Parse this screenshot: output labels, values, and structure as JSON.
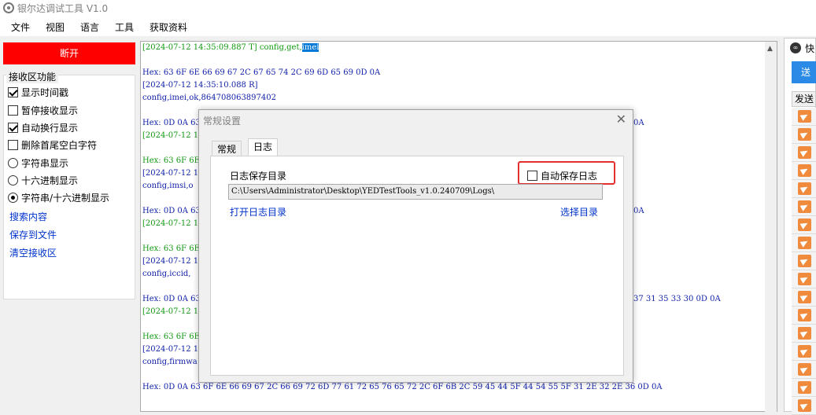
{
  "window": {
    "title": "银尔达调试工具 V1.0"
  },
  "menu": [
    "文件",
    "视图",
    "语言",
    "工具",
    "获取资料"
  ],
  "left": {
    "disconnect_label": "断开",
    "group_title": "接收区功能",
    "options": [
      {
        "label": "显示时间戳",
        "type": "checkbox",
        "checked": true
      },
      {
        "label": "暂停接收显示",
        "type": "checkbox",
        "checked": false
      },
      {
        "label": "自动换行显示",
        "type": "checkbox",
        "checked": true
      },
      {
        "label": "删除首尾空白字符",
        "type": "checkbox",
        "checked": false
      },
      {
        "label": "字符串显示",
        "type": "radio",
        "checked": false
      },
      {
        "label": "十六进制显示",
        "type": "radio",
        "checked": false
      },
      {
        "label": "字符串/十六进制显示",
        "type": "radio",
        "checked": true
      }
    ],
    "links": [
      "搜索内容",
      "保存到文件",
      "清空接收区"
    ]
  },
  "log": {
    "lines": [
      {
        "color": "green",
        "text": "[2024-07-12 14:35:09.887 T] config,get,",
        "sel": "imei"
      },
      {
        "color": "blue",
        "text": "Hex: 63 6F 6E 66 69 67 2C 67 65 74 2C 69 6D 65 69 0D 0A"
      },
      {
        "color": "blue",
        "text": "[2024-07-12 14:35:10.088 R]"
      },
      {
        "color": "blue",
        "text": "config,imei,ok,864708063897402"
      },
      {
        "color": "blue",
        "text": "Hex: 0D 0A 63"
      },
      {
        "color": "green",
        "text": "[2024-07-12 1"
      },
      {
        "color": "green",
        "text": "Hex: 63 6F 6E"
      },
      {
        "color": "blue",
        "text": "[2024-07-12 1"
      },
      {
        "color": "blue",
        "text": "config,imsi,o"
      },
      {
        "color": "blue",
        "text": "Hex: 0D 0A 63"
      },
      {
        "color": "green",
        "text": "[2024-07-12 1"
      },
      {
        "color": "green",
        "text": "Hex: 63 6F 6E"
      },
      {
        "color": "blue",
        "text": "[2024-07-12 1"
      },
      {
        "color": "blue",
        "text": "config,iccid,"
      },
      {
        "color": "blue",
        "text": "Hex: 0D 0A 63"
      },
      {
        "color": "green",
        "text": "[2024-07-12 1"
      },
      {
        "color": "green",
        "text": "Hex: 63 6F 6E"
      },
      {
        "color": "blue",
        "text": "[2024-07-12 1"
      },
      {
        "color": "blue",
        "text": "config,firmwa"
      },
      {
        "color": "blue",
        "text": "Hex: 0D 0A 63 6F 6E 66 69 67 2C 66 69 72 6D 77 61 72 65 76 65 72 2C 6F 6B 2C 59 45 44 5F 44 54 55 5F 31 2E 32 2E 36 0D 0A"
      }
    ],
    "tails": [
      {
        "text": "0A"
      },
      {
        "text": "0A"
      },
      {
        "text": "37 31 35 33 30 0D 0A"
      }
    ]
  },
  "right": {
    "header_label": "快",
    "send_btn_label": "送",
    "col_label": "发送"
  },
  "dialog": {
    "title": "常规设置",
    "close": "✕",
    "tabs": [
      "常规",
      "日志"
    ],
    "dir_label": "日志保存目录",
    "auto_save_label": "自动保存日志",
    "auto_save_checked": false,
    "path": "C:\\Users\\Administrator\\Desktop\\YEDTestTools_v1.0.240709\\Logs\\",
    "open_link": "打开日志目录",
    "select_link": "选择目录"
  }
}
